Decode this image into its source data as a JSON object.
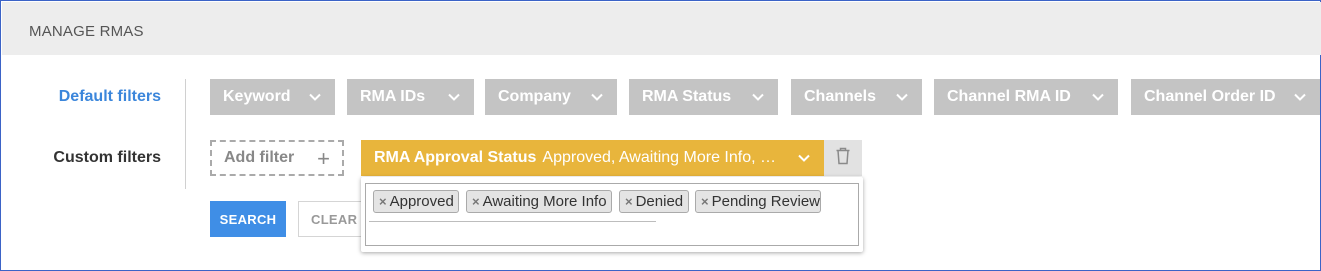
{
  "header": {
    "title": "MANAGE RMAS"
  },
  "filters": {
    "default_label": "Default filters",
    "custom_label": "Custom filters",
    "default_chips": [
      {
        "label": "Keyword"
      },
      {
        "label": "RMA IDs"
      },
      {
        "label": "Company"
      },
      {
        "label": "RMA Status"
      },
      {
        "label": "Channels"
      },
      {
        "label": "Channel RMA ID"
      },
      {
        "label": "Channel Order ID"
      }
    ],
    "add_filter_label": "Add filter",
    "add_filter_icon": "+",
    "active_filter": {
      "name": "RMA Approval Status",
      "value": "Approved, Awaiting More Info, Denied, Pending Review"
    }
  },
  "buttons": {
    "search": "SEARCH",
    "clear": "CLEAR"
  },
  "dropdown": {
    "tags": [
      {
        "label": "Approved"
      },
      {
        "label": "Awaiting More Info"
      },
      {
        "label": "Denied"
      },
      {
        "label": "Pending Review"
      }
    ],
    "remove_glyph": "×"
  },
  "colors": {
    "accent": "#3b86db",
    "chip_default": "#c4c4c4",
    "chip_active": "#e8b53c",
    "primary_button": "#3f8ee6"
  }
}
